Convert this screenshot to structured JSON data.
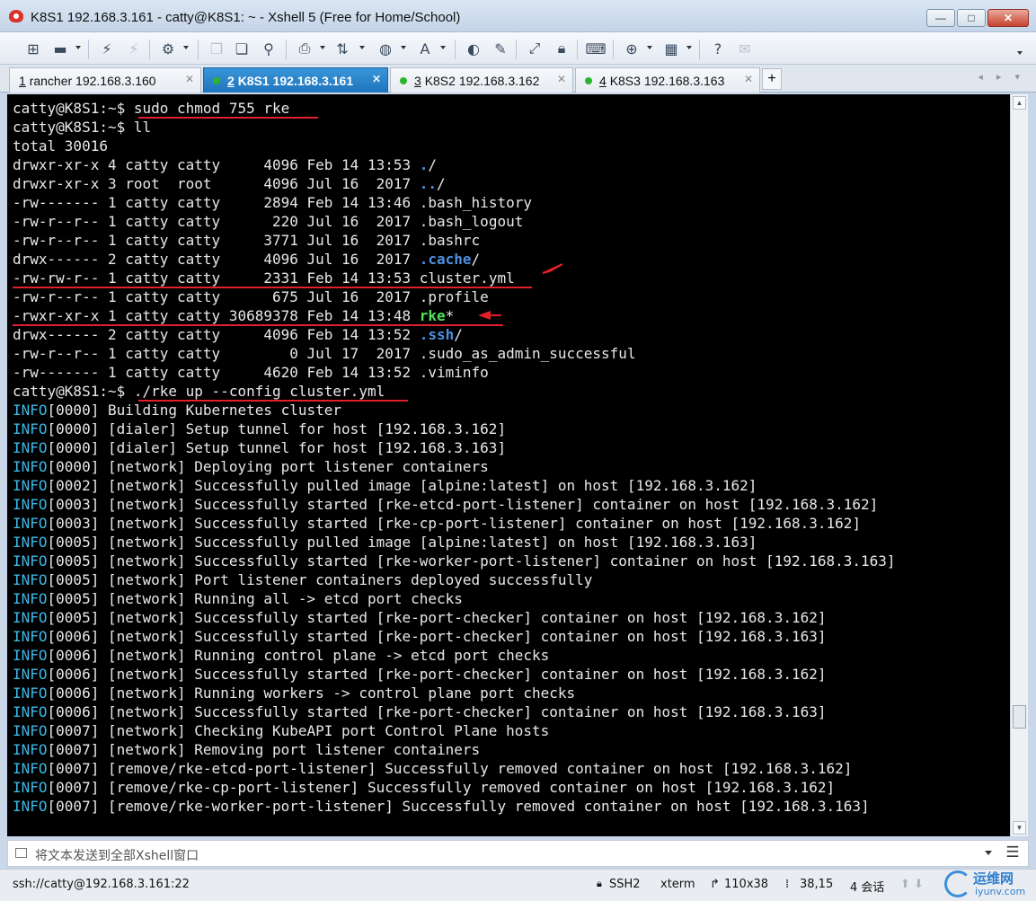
{
  "window": {
    "title": "K8S1 192.168.3.161 - catty@K8S1: ~ - Xshell 5 (Free for Home/School)",
    "minimize": "—",
    "maximize": "□",
    "close": "✕"
  },
  "toolbar": {
    "icons": [
      "new-session-icon",
      "open-folder-icon",
      "connect-icon",
      "disconnect-icon",
      "properties-icon",
      "copy-icon",
      "paste-icon",
      "find-icon",
      "print-icon",
      "transfer-icon",
      "globe-icon",
      "font-icon",
      "script-icon",
      "compose-icon",
      "fullscreen-icon",
      "lock-icon",
      "keyboard-icon",
      "add-icon",
      "layout-icon",
      "help-icon",
      "chat-icon"
    ]
  },
  "tabs": [
    {
      "num": "1",
      "label": "rancher 192.168.3.160",
      "active": false,
      "dot": false
    },
    {
      "num": "2",
      "label": "K8S1 192.168.3.161",
      "active": true,
      "dot": true
    },
    {
      "num": "3",
      "label": "K8S2 192.168.3.162",
      "active": false,
      "dot": true
    },
    {
      "num": "4",
      "label": "K8S3 192.168.3.163",
      "active": false,
      "dot": true
    }
  ],
  "terminal": {
    "lines": [
      "catty@K8S1:~$ sudo chmod 755 rke",
      "catty@K8S1:~$ ll",
      "total 30016",
      "drwxr-xr-x 4 catty catty     4096 Feb 14 13:53 ./",
      "drwxr-xr-x 3 root  root      4096 Jul 16  2017 ../",
      "-rw------- 1 catty catty     2894 Feb 14 13:46 .bash_history",
      "-rw-r--r-- 1 catty catty      220 Jul 16  2017 .bash_logout",
      "-rw-r--r-- 1 catty catty     3771 Jul 16  2017 .bashrc",
      "drwx------ 2 catty catty     4096 Jul 16  2017 .cache/",
      "-rw-rw-r-- 1 catty catty     2331 Feb 14 13:53 cluster.yml",
      "-rw-r--r-- 1 catty catty      675 Jul 16  2017 .profile",
      "-rwxr-xr-x 1 catty catty 30689378 Feb 14 13:48 rke*",
      "drwx------ 2 catty catty     4096 Feb 14 13:52 .ssh/",
      "-rw-r--r-- 1 catty catty        0 Jul 17  2017 .sudo_as_admin_successful",
      "-rw------- 1 catty catty     4620 Feb 14 13:52 .viminfo",
      "catty@K8S1:~$ ./rke up --config cluster.yml",
      "INFO[0000] Building Kubernetes cluster",
      "INFO[0000] [dialer] Setup tunnel for host [192.168.3.162]",
      "INFO[0000] [dialer] Setup tunnel for host [192.168.3.163]",
      "INFO[0000] [network] Deploying port listener containers",
      "INFO[0002] [network] Successfully pulled image [alpine:latest] on host [192.168.3.162]",
      "INFO[0003] [network] Successfully started [rke-etcd-port-listener] container on host [192.168.3.162]",
      "INFO[0003] [network] Successfully started [rke-cp-port-listener] container on host [192.168.3.162]",
      "INFO[0005] [network] Successfully pulled image [alpine:latest] on host [192.168.3.163]",
      "INFO[0005] [network] Successfully started [rke-worker-port-listener] container on host [192.168.3.163]",
      "INFO[0005] [network] Port listener containers deployed successfully",
      "INFO[0005] [network] Running all -> etcd port checks",
      "INFO[0005] [network] Successfully started [rke-port-checker] container on host [192.168.3.162]",
      "INFO[0006] [network] Successfully started [rke-port-checker] container on host [192.168.3.163]",
      "INFO[0006] [network] Running control plane -> etcd port checks",
      "INFO[0006] [network] Successfully started [rke-port-checker] container on host [192.168.3.162]",
      "INFO[0006] [network] Running workers -> control plane port checks",
      "INFO[0006] [network] Successfully started [rke-port-checker] container on host [192.168.3.163]",
      "INFO[0007] [network] Checking KubeAPI port Control Plane hosts",
      "INFO[0007] [network] Removing port listener containers",
      "INFO[0007] [remove/rke-etcd-port-listener] Successfully removed container on host [192.168.3.162]",
      "INFO[0007] [remove/rke-cp-port-listener] Successfully removed container on host [192.168.3.162]",
      "INFO[0007] [remove/rke-worker-port-listener] Successfully removed container on host [192.168.3.163]"
    ],
    "colors": {
      "background": "#000000",
      "text": "#e8e8e8",
      "info": "#3db7e6",
      "directory": "#4d8fe0",
      "executable": "#55e05a",
      "annotation": "#e0202a"
    }
  },
  "compose_bar": {
    "placeholder": "将文本发送到全部Xshell窗口"
  },
  "status_bar": {
    "connection": "ssh://catty@192.168.3.161:22",
    "protocol": "SSH2",
    "terminal_type": "xterm",
    "size": "110x38",
    "cursor": "38,15",
    "sessions": "4 会话"
  },
  "watermark": {
    "text": "运维网",
    "sub": "iyunv.com"
  }
}
